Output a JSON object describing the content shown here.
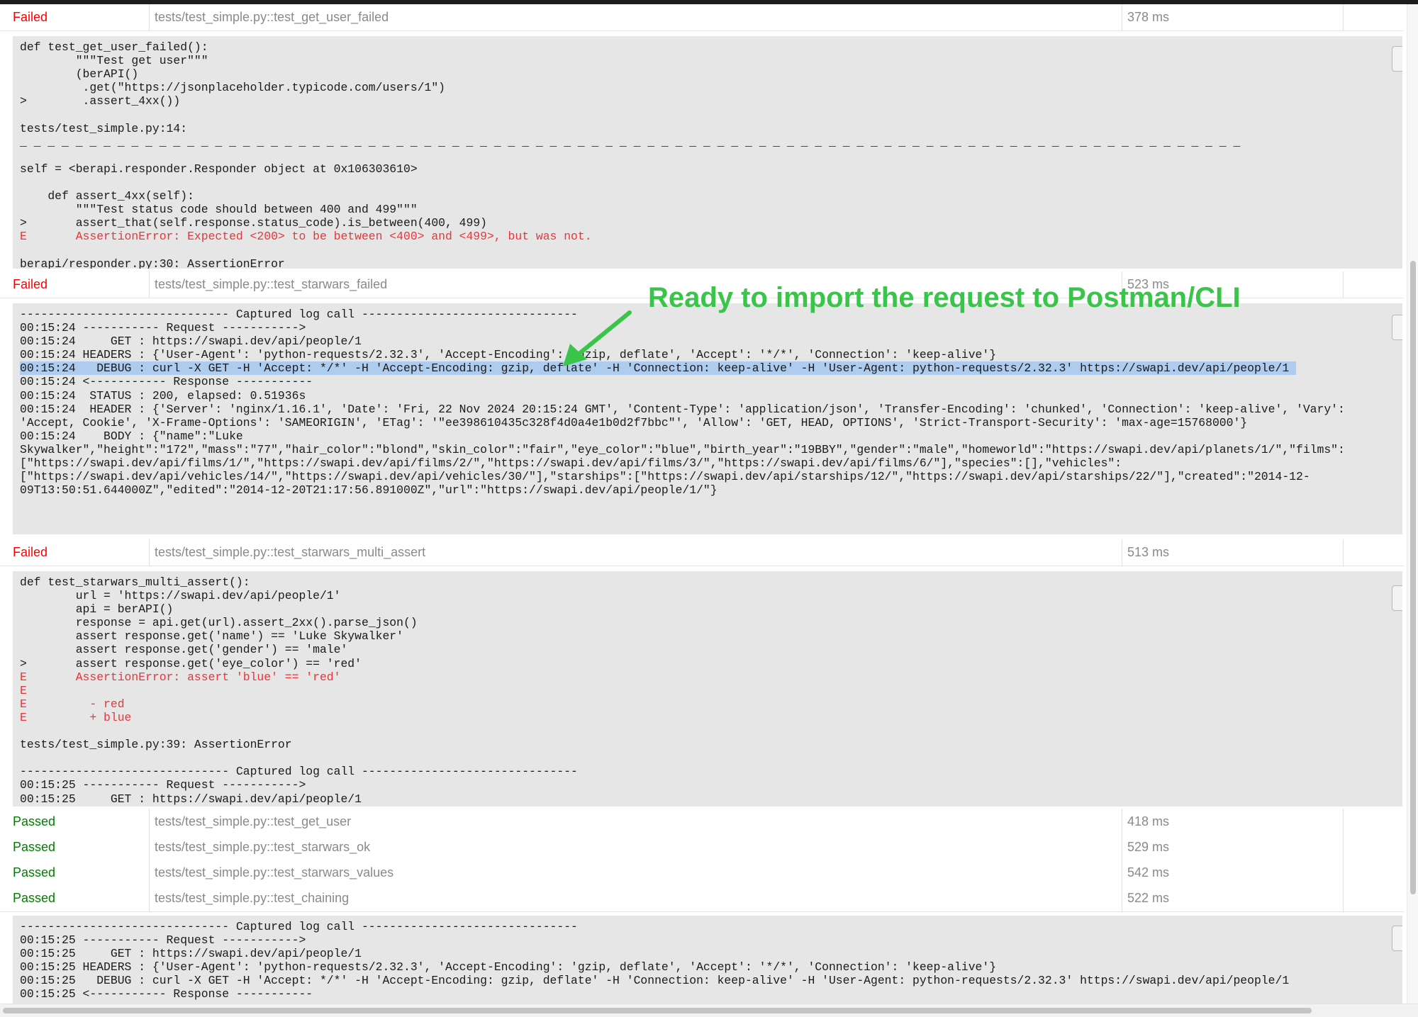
{
  "results": [
    {
      "result": "Failed",
      "test": "tests/test_simple.py::test_get_user_failed",
      "duration": "378 ms"
    },
    {
      "result": "Failed",
      "test": "tests/test_simple.py::test_starwars_failed",
      "duration": "523 ms"
    },
    {
      "result": "Failed",
      "test": "tests/test_simple.py::test_starwars_multi_assert",
      "duration": "513 ms"
    },
    {
      "result": "Passed",
      "test": "tests/test_simple.py::test_get_user",
      "duration": "418 ms"
    },
    {
      "result": "Passed",
      "test": "tests/test_simple.py::test_starwars_ok",
      "duration": "529 ms"
    },
    {
      "result": "Passed",
      "test": "tests/test_simple.py::test_starwars_values",
      "duration": "542 ms"
    },
    {
      "result": "Passed",
      "test": "tests/test_simple.py::test_chaining",
      "duration": "522 ms"
    }
  ],
  "logs": {
    "get_user_failed": [
      {
        "text": "def test_get_user_failed():"
      },
      {
        "text": "        \"\"\"Test get user\"\"\""
      },
      {
        "text": "        (berAPI()"
      },
      {
        "text": "         .get(\"https://jsonplaceholder.typicode.com/users/1\")"
      },
      {
        "text": ">        .assert_4xx())"
      },
      {
        "text": ""
      },
      {
        "text": "tests/test_simple.py:14:"
      },
      {
        "text": "_ _ _ _ _ _ _ _ _ _ _ _ _ _ _ _ _ _ _ _ _ _ _ _ _ _ _ _ _ _ _ _ _ _ _ _ _ _ _ _ _ _ _ _ _ _ _ _ _ _ _ _ _ _ _ _ _ _ _ _ _ _ _ _ _ _ _ _ _ _ _ _ _ _ _ _ _ _ _ _ _ _ _ _ _ _ _ _"
      },
      {
        "text": ""
      },
      {
        "text": "self = <berapi.responder.Responder object at 0x106303610>"
      },
      {
        "text": ""
      },
      {
        "text": "    def assert_4xx(self):"
      },
      {
        "text": "        \"\"\"Test status code should between 400 and 499\"\"\""
      },
      {
        "text": ">       assert_that(self.response.status_code).is_between(400, 499)"
      },
      {
        "text": "E       AssertionError: Expected <200> to be between <400> and <499>, but was not.",
        "err": true
      },
      {
        "text": ""
      },
      {
        "text": "berapi/responder.py:30: AssertionError"
      }
    ],
    "starwars_failed": [
      {
        "text": "------------------------------ Captured log call -------------------------------"
      },
      {
        "text": "00:15:24 ----------- Request ----------->"
      },
      {
        "text": "00:15:24     GET : https://swapi.dev/api/people/1"
      },
      {
        "text": "00:15:24 HEADERS : {'User-Agent': 'python-requests/2.32.3', 'Accept-Encoding': 'gzip, deflate', 'Accept': '*/*', 'Connection': 'keep-alive'}"
      },
      {
        "text": "00:15:24   DEBUG : curl -X GET -H 'Accept: */*' -H 'Accept-Encoding: gzip, deflate' -H 'Connection: keep-alive' -H 'User-Agent: python-requests/2.32.3' https://swapi.dev/api/people/1 ",
        "hl": true
      },
      {
        "text": "00:15:24 <----------- Response -----------"
      },
      {
        "text": "00:15:24  STATUS : 200, elapsed: 0.51936s"
      },
      {
        "text": "00:15:24  HEADER : {'Server': 'nginx/1.16.1', 'Date': 'Fri, 22 Nov 2024 20:15:24 GMT', 'Content-Type': 'application/json', 'Transfer-Encoding': 'chunked', 'Connection': 'keep-alive', 'Vary':"
      },
      {
        "text": "'Accept, Cookie', 'X-Frame-Options': 'SAMEORIGIN', 'ETag': '\"ee398610435c328f4d0a4e1b0d2f7bbc\"', 'Allow': 'GET, HEAD, OPTIONS', 'Strict-Transport-Security': 'max-age=15768000'}"
      },
      {
        "text": "00:15:24    BODY : {\"name\":\"Luke"
      },
      {
        "text": "Skywalker\",\"height\":\"172\",\"mass\":\"77\",\"hair_color\":\"blond\",\"skin_color\":\"fair\",\"eye_color\":\"blue\",\"birth_year\":\"19BBY\",\"gender\":\"male\",\"homeworld\":\"https://swapi.dev/api/planets/1/\",\"films\":"
      },
      {
        "text": "[\"https://swapi.dev/api/films/1/\",\"https://swapi.dev/api/films/2/\",\"https://swapi.dev/api/films/3/\",\"https://swapi.dev/api/films/6/\"],\"species\":[],\"vehicles\":"
      },
      {
        "text": "[\"https://swapi.dev/api/vehicles/14/\",\"https://swapi.dev/api/vehicles/30/\"],\"starships\":[\"https://swapi.dev/api/starships/12/\",\"https://swapi.dev/api/starships/22/\"],\"created\":\"2014-12-"
      },
      {
        "text": "09T13:50:51.644000Z\",\"edited\":\"2014-12-20T21:17:56.891000Z\",\"url\":\"https://swapi.dev/api/people/1/\"}"
      }
    ],
    "multi_assert": [
      {
        "text": "def test_starwars_multi_assert():"
      },
      {
        "text": "        url = 'https://swapi.dev/api/people/1'"
      },
      {
        "text": "        api = berAPI()"
      },
      {
        "text": "        response = api.get(url).assert_2xx().parse_json()"
      },
      {
        "text": "        assert response.get('name') == 'Luke Skywalker'"
      },
      {
        "text": "        assert response.get('gender') == 'male'"
      },
      {
        "text": ">       assert response.get('eye_color') == 'red'"
      },
      {
        "text": "E       AssertionError: assert 'blue' == 'red'",
        "err": true
      },
      {
        "text": "E",
        "err": true
      },
      {
        "text": "E         - red",
        "err": true
      },
      {
        "text": "E         + blue",
        "err": true
      },
      {
        "text": ""
      },
      {
        "text": "tests/test_simple.py:39: AssertionError"
      },
      {
        "text": ""
      },
      {
        "text": "------------------------------ Captured log call -------------------------------"
      },
      {
        "text": "00:15:25 ----------- Request ----------->"
      },
      {
        "text": "00:15:25     GET : https://swapi.dev/api/people/1"
      }
    ],
    "chaining": [
      {
        "text": "------------------------------ Captured log call -------------------------------"
      },
      {
        "text": "00:15:25 ----------- Request ----------->"
      },
      {
        "text": "00:15:25     GET : https://swapi.dev/api/people/1"
      },
      {
        "text": "00:15:25 HEADERS : {'User-Agent': 'python-requests/2.32.3', 'Accept-Encoding': 'gzip, deflate', 'Accept': '*/*', 'Connection': 'keep-alive'}"
      },
      {
        "text": "00:15:25   DEBUG : curl -X GET -H 'Accept: */*' -H 'Accept-Encoding: gzip, deflate' -H 'Connection: keep-alive' -H 'User-Agent: python-requests/2.32.3' https://swapi.dev/api/people/1"
      },
      {
        "text": "00:15:25 <----------- Response -----------"
      }
    ]
  },
  "annotation": {
    "text": "Ready to import the request to Postman/CLI",
    "color": "#3ac44a"
  },
  "colors": {
    "failed": "#ff0000",
    "passed": "#008000",
    "error_text": "#e8363a",
    "highlight": "#aeccee",
    "log_background": "#e6e6e6"
  }
}
